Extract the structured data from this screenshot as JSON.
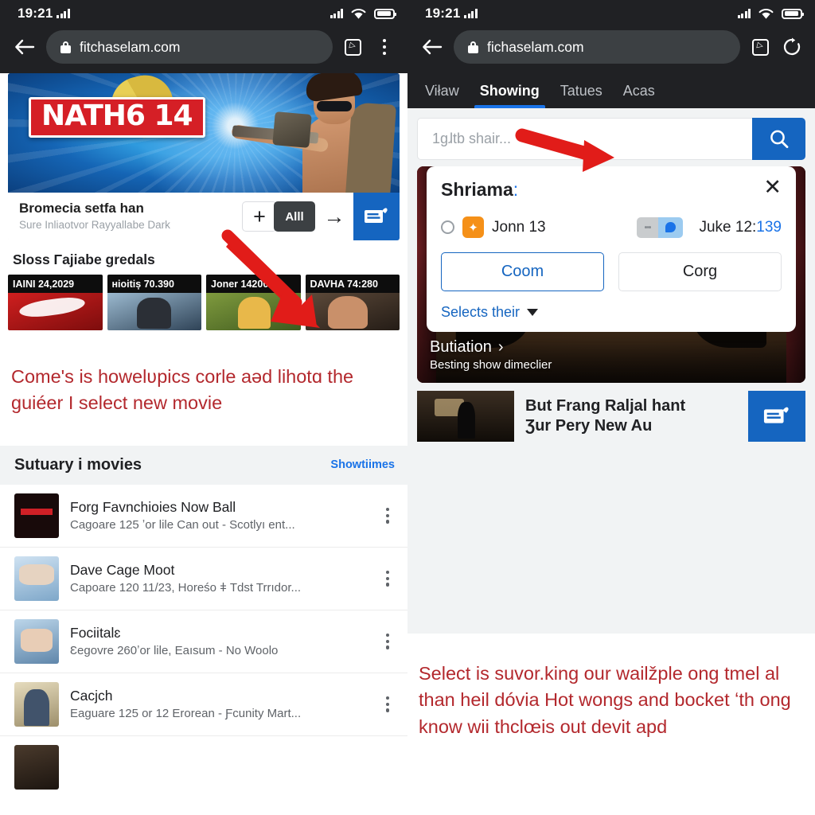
{
  "left": {
    "status": {
      "time": "19:21"
    },
    "browser": {
      "url": "fitchaselam.com",
      "lock_icon": "lock-icon",
      "back_icon": "back-arrow-icon",
      "tabs_icon": "tab-switcher-icon",
      "menu_icon": "kebab-menu-icon"
    },
    "hero": {
      "badge": "NATH6 14",
      "title": "Bromecia setfa han",
      "subtitle": "Sure Inliaotvor Rayyallabe Dark",
      "plus_label": "+",
      "all_label": "Alll",
      "arrow_label": "→"
    },
    "section_title": "Sloss Γajiabe gredals",
    "thumbs": [
      {
        "caption": "IAINI 24,2029"
      },
      {
        "caption": "ʜiоіtiș 70.390"
      },
      {
        "caption": "Joner 142000"
      },
      {
        "caption": "DAVHA 74:280"
      }
    ],
    "annotation": "Comeʹs is howelʋpics corle aəd lihotɑ the guiéer I select new movie",
    "list": {
      "header_title": "Sutuary i movies",
      "header_link": "Showtiimes",
      "rows": [
        {
          "title": "Forg Favnchioies Now Ball",
          "sub": "Cagoare 125 ʼor lile Can out - Scotlyı ent..."
        },
        {
          "title": "Dave Cage Moot",
          "sub": "Capoare 120 11/23, Horeśo ǂ Tdst Trrıdor..."
        },
        {
          "title": "Fociitalɛ",
          "sub": "Ɛegovre 260ʼor lile, Eaısum - No Woolo"
        },
        {
          "title": "Cacjch",
          "sub": "Eaguare 125 or 12 Erorean - Ƒcunity Mart..."
        }
      ]
    }
  },
  "right": {
    "status": {
      "time": "19:21"
    },
    "browser": {
      "url": "fichaselam.com",
      "lock_icon": "lock-icon",
      "back_icon": "back-arrow-icon",
      "tabs_icon": "tab-switcher-icon",
      "reload_icon": "reload-icon"
    },
    "tabs": [
      {
        "label": "Viław",
        "active": false
      },
      {
        "label": "Showing",
        "active": true
      },
      {
        "label": "Tatues",
        "active": false
      },
      {
        "label": "Acas",
        "active": false
      }
    ],
    "search": {
      "placeholder": "1gɺtb shair...",
      "button_icon": "search-icon"
    },
    "dialog": {
      "title": "Shriama",
      "title_colon": ":",
      "close_icon": "close-icon",
      "option_label": "Jonn 13",
      "option_badge_icon": "sparkle-icon",
      "pill_label": "Juke 12:",
      "pill_value": "139",
      "pill_icon": "shield-icon",
      "primary_button": "Coom",
      "secondary_button": "Corg",
      "footer_link": "Selects their",
      "footer_caret_icon": "chevron-down-icon"
    },
    "media": {
      "caption_title": "Butiation",
      "caption_chevron": "›",
      "caption_sub": "Besting show dimeclier"
    },
    "promo": {
      "line1": "But Frang Raljal hant",
      "line2": "Ʒur Pery New Au",
      "button_icon": "note-hand-icon"
    },
    "annotation": "Select is suvor.king our wailžple ong tmel al than heil dóvia Hot wongs and bocket ʻth ong know wii thclœis out devit apd"
  },
  "colors": {
    "accent_blue": "#1565c0",
    "link_blue": "#1a73e8",
    "annotation_red": "#b3282d",
    "arrow_red": "#e11c19",
    "chrome_dark": "#202124",
    "orange_badge": "#f59018"
  }
}
